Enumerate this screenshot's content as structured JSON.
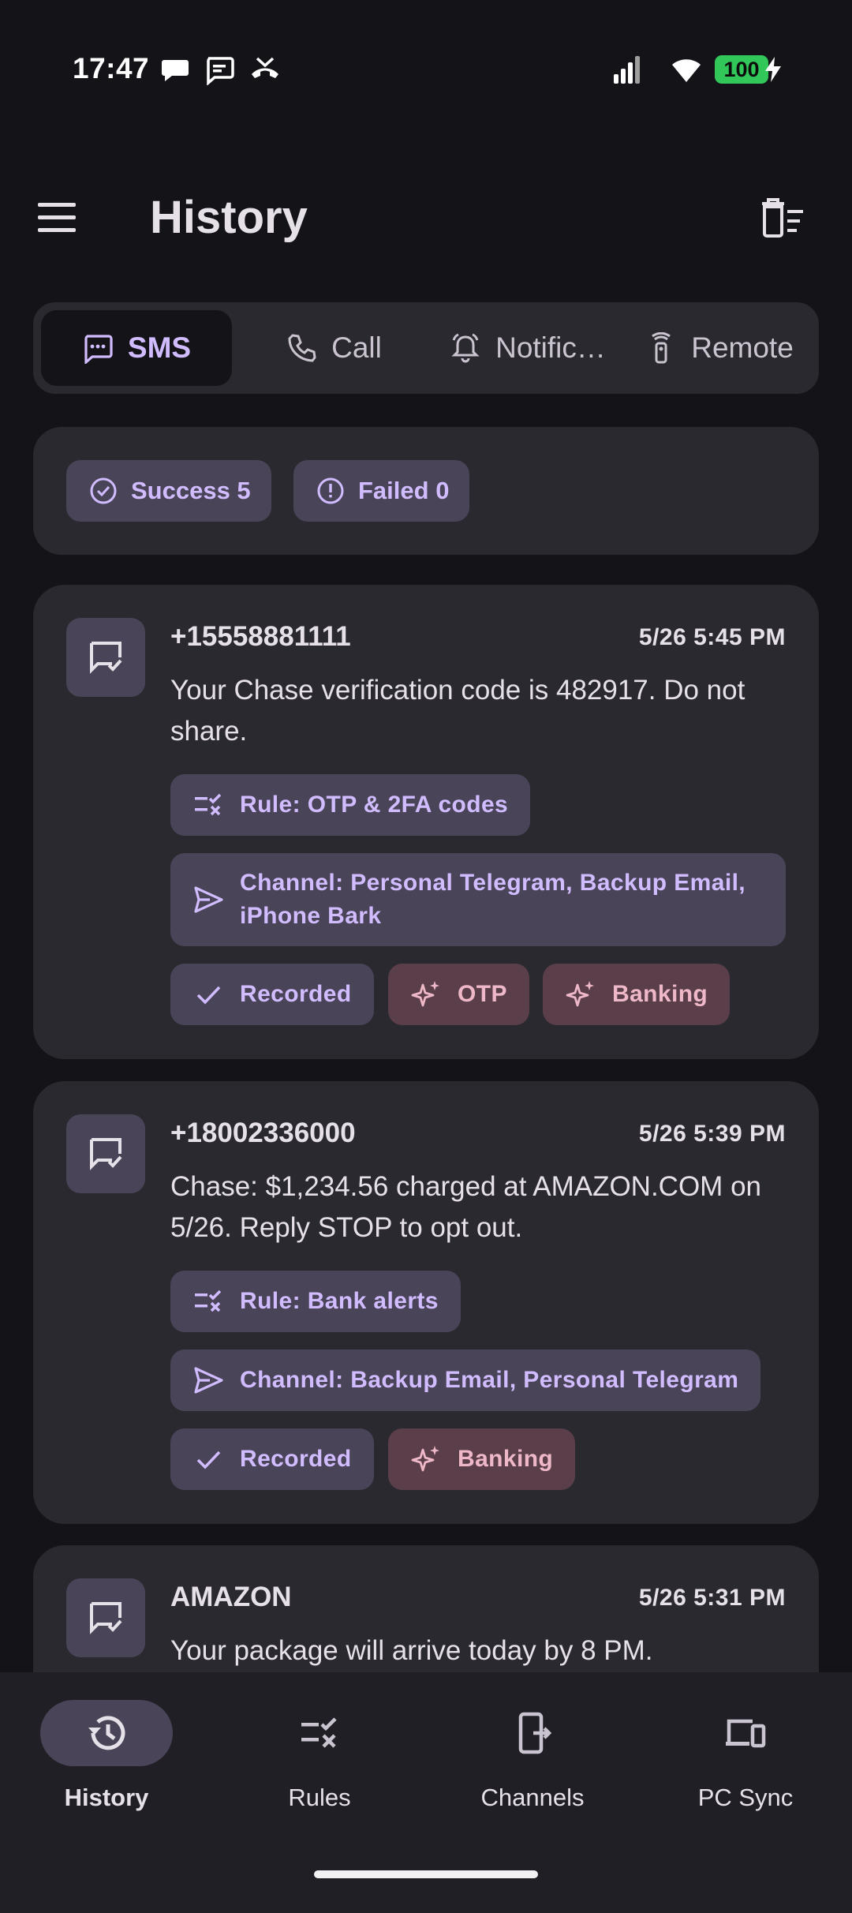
{
  "status_bar": {
    "time": "17:47",
    "battery": "100",
    "icons": [
      "chat-bubble-icon",
      "sms-icon",
      "missed-call-icon",
      "signal-icon",
      "wifi-icon",
      "battery-charging-icon"
    ]
  },
  "app_bar": {
    "title": "History",
    "menu_icon": "menu-icon",
    "action_icon": "delete-sweep-icon"
  },
  "tabs": [
    {
      "label": "SMS",
      "icon": "sms-icon",
      "selected": true
    },
    {
      "label": "Call",
      "icon": "phone-icon",
      "selected": false
    },
    {
      "label": "Notific…",
      "icon": "notification-bell-icon",
      "selected": false
    },
    {
      "label": "Remote",
      "icon": "remote-icon",
      "selected": false
    }
  ],
  "summary": {
    "success_label": "Success 5",
    "failed_label": "Failed 0"
  },
  "messages": [
    {
      "sender": "+15558881111",
      "time": "5/26 5:45 PM",
      "body": "Your Chase verification code is 482917. Do not share.",
      "rule": "Rule: OTP & 2FA codes",
      "channel": "Channel: Personal Telegram, Backup Email, iPhone Bark",
      "status": "Recorded",
      "tags": [
        "OTP",
        "Banking"
      ]
    },
    {
      "sender": "+18002336000",
      "time": "5/26 5:39 PM",
      "body": "Chase: $1,234.56 charged at AMAZON.COM on 5/26. Reply STOP to opt out.",
      "rule": "Rule: Bank alerts",
      "channel": "Channel: Backup Email, Personal Telegram",
      "status": "Recorded",
      "tags": [
        "Banking"
      ]
    },
    {
      "sender": "AMAZON",
      "time": "5/26 5:31 PM",
      "body": "Your package will arrive today by 8 PM."
    }
  ],
  "bottom_nav": [
    {
      "label": "History",
      "icon": "history-icon",
      "selected": true
    },
    {
      "label": "Rules",
      "icon": "rules-icon",
      "selected": false
    },
    {
      "label": "Channels",
      "icon": "channels-icon",
      "selected": false
    },
    {
      "label": "PC Sync",
      "icon": "devices-icon",
      "selected": false
    }
  ],
  "colors": {
    "background": "#141318",
    "surface": "#2b2930",
    "chip": "#4a4458",
    "accent": "#d0bcff",
    "pink_chip": "#5a3f4a",
    "pink_text": "#efb8c8",
    "battery": "#32c759"
  }
}
